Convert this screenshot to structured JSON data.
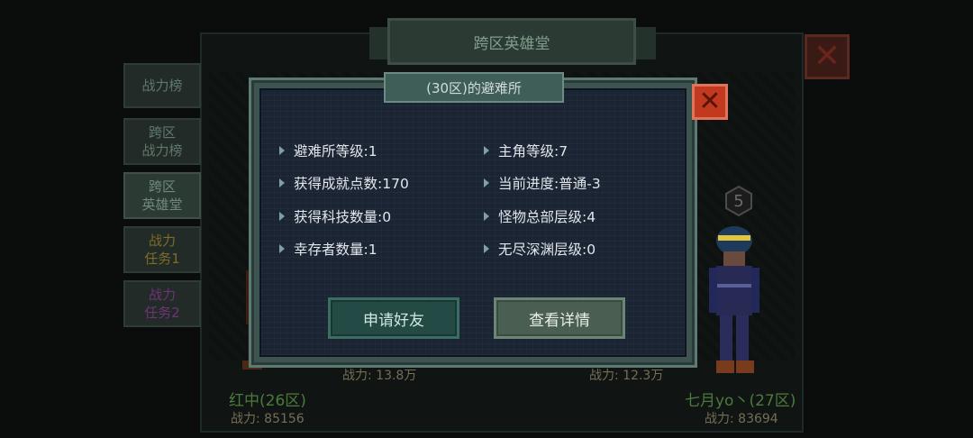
{
  "background": {
    "window_title": "跨区英雄堂",
    "close_glyph": "✕",
    "side_tabs": [
      {
        "label": "战力榜"
      },
      {
        "label": "跨区\n战力榜"
      },
      {
        "label": "跨区\n英雄堂"
      },
      {
        "label": "战力\n任务1"
      },
      {
        "label": "战力\n任务2"
      }
    ],
    "players": [
      {
        "name": "红中(26区)",
        "power": "战力: 85156",
        "power_partial": "战力: 13.8万"
      },
      {
        "name": "七月yo丶(27区)",
        "power": "战力: 83694",
        "power_partial": "战力: 12.3万"
      }
    ],
    "rank_badge": "5"
  },
  "modal": {
    "title": "(30区)的避难所",
    "close_glyph": "✕",
    "stats_left": [
      "避难所等级:1",
      "获得成就点数:170",
      "获得科技数量:0",
      "幸存者数量:1"
    ],
    "stats_right": [
      "主角等级:7",
      "当前进度:普通-3",
      "怪物总部层级:4",
      "无尽深渊层级:0"
    ],
    "buttons": {
      "add_friend": "申请好友",
      "view_details": "查看详情"
    }
  },
  "colors": {
    "modal_bg": "#1a2433",
    "close_red": "#c13a20",
    "name_green": "#4c7a3c"
  }
}
